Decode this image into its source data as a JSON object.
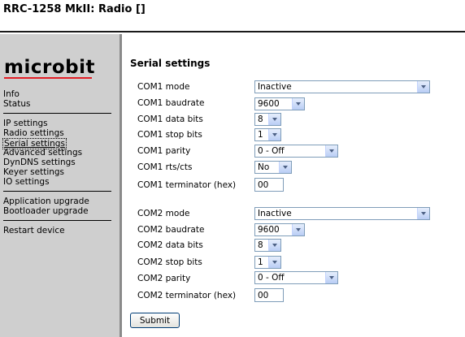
{
  "window": {
    "title": "RRC-1258 MkII: Radio []"
  },
  "logo": {
    "text": "microbit"
  },
  "sidebar": {
    "items": [
      {
        "label": "Info"
      },
      {
        "label": "Status"
      },
      {
        "label": "IP settings"
      },
      {
        "label": "Radio settings"
      },
      {
        "label": "Serial settings"
      },
      {
        "label": "Advanced settings"
      },
      {
        "label": "DynDNS settings"
      },
      {
        "label": "Keyer settings"
      },
      {
        "label": "IO settings"
      },
      {
        "label": "Application upgrade"
      },
      {
        "label": "Bootloader upgrade"
      },
      {
        "label": "Restart device"
      }
    ]
  },
  "main": {
    "heading": "Serial settings",
    "com1": {
      "mode_label": "COM1 mode",
      "mode_value": "Inactive",
      "baud_label": "COM1 baudrate",
      "baud_value": "9600",
      "databits_label": "COM1 data bits",
      "databits_value": "8",
      "stopbits_label": "COM1 stop bits",
      "stopbits_value": "1",
      "parity_label": "COM1 parity",
      "parity_value": "0 - Off",
      "rtscts_label": "COM1 rts/cts",
      "rtscts_value": "No",
      "term_label": "COM1 terminator (hex)",
      "term_value": "00"
    },
    "com2": {
      "mode_label": "COM2 mode",
      "mode_value": "Inactive",
      "baud_label": "COM2 baudrate",
      "baud_value": "9600",
      "databits_label": "COM2 data bits",
      "databits_value": "8",
      "stopbits_label": "COM2 stop bits",
      "stopbits_value": "1",
      "parity_label": "COM2 parity",
      "parity_value": "0 - Off",
      "term_label": "COM2 terminator (hex)",
      "term_value": "00"
    },
    "submit_label": "Submit"
  }
}
